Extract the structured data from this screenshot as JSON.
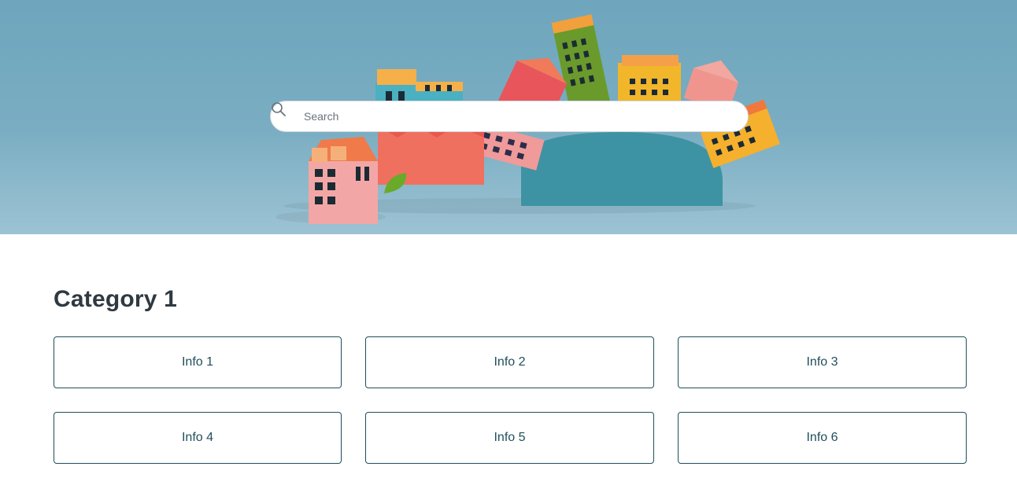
{
  "hero": {
    "colors": {
      "sky": "#7aadc2",
      "ground": "#9cc3d4"
    }
  },
  "search": {
    "placeholder": "Search",
    "value": ""
  },
  "category": {
    "title": "Category 1",
    "items": [
      {
        "label": "Info 1"
      },
      {
        "label": "Info 2"
      },
      {
        "label": "Info 3"
      },
      {
        "label": "Info 4"
      },
      {
        "label": "Info 5"
      },
      {
        "label": "Info 6"
      }
    ]
  },
  "colors": {
    "card_border": "#1f4f5a",
    "card_text": "#1f4f5a",
    "title_text": "#2f3941"
  }
}
